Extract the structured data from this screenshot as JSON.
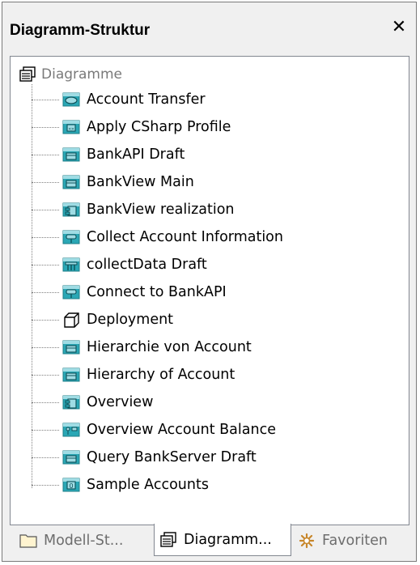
{
  "window": {
    "title": "Diagramm-Struktur",
    "close_glyph": "✕"
  },
  "tree": {
    "root_label": "Diagramme",
    "root_icon": "diagram-stack-icon",
    "items": [
      {
        "label": "Account Transfer",
        "icon": "usecase-diagram-icon"
      },
      {
        "label": "Apply CSharp Profile",
        "icon": "profile-diagram-icon"
      },
      {
        "label": "BankAPI Draft",
        "icon": "class-diagram-icon"
      },
      {
        "label": "BankView Main",
        "icon": "class-diagram-icon"
      },
      {
        "label": "BankView realization",
        "icon": "component-diagram-icon"
      },
      {
        "label": "Collect Account Information",
        "icon": "activity-diagram-icon"
      },
      {
        "label": "collectData Draft",
        "icon": "sequence-diagram-icon"
      },
      {
        "label": "Connect to BankAPI",
        "icon": "activity-diagram-icon"
      },
      {
        "label": "Deployment",
        "icon": "deployment-diagram-icon"
      },
      {
        "label": "Hierarchie von Account",
        "icon": "class-diagram-icon"
      },
      {
        "label": "Hierarchy of Account",
        "icon": "class-diagram-icon"
      },
      {
        "label": "Overview",
        "icon": "component-diagram-icon"
      },
      {
        "label": "Overview Account Balance",
        "icon": "composite-diagram-icon"
      },
      {
        "label": "Query BankServer Draft",
        "icon": "class-diagram-icon"
      },
      {
        "label": "Sample Accounts",
        "icon": "object-diagram-icon"
      }
    ]
  },
  "tabs": [
    {
      "label": "Modell-St...",
      "icon": "folder-icon",
      "active": false
    },
    {
      "label": "Diagramm...",
      "icon": "diagram-stack-icon",
      "active": true
    },
    {
      "label": "Favoriten",
      "icon": "favorites-icon",
      "active": false
    }
  ],
  "colors": {
    "icon_fill": "#2aa7b5",
    "icon_light": "#9fdce4",
    "favorites_star": "#c7862a"
  }
}
